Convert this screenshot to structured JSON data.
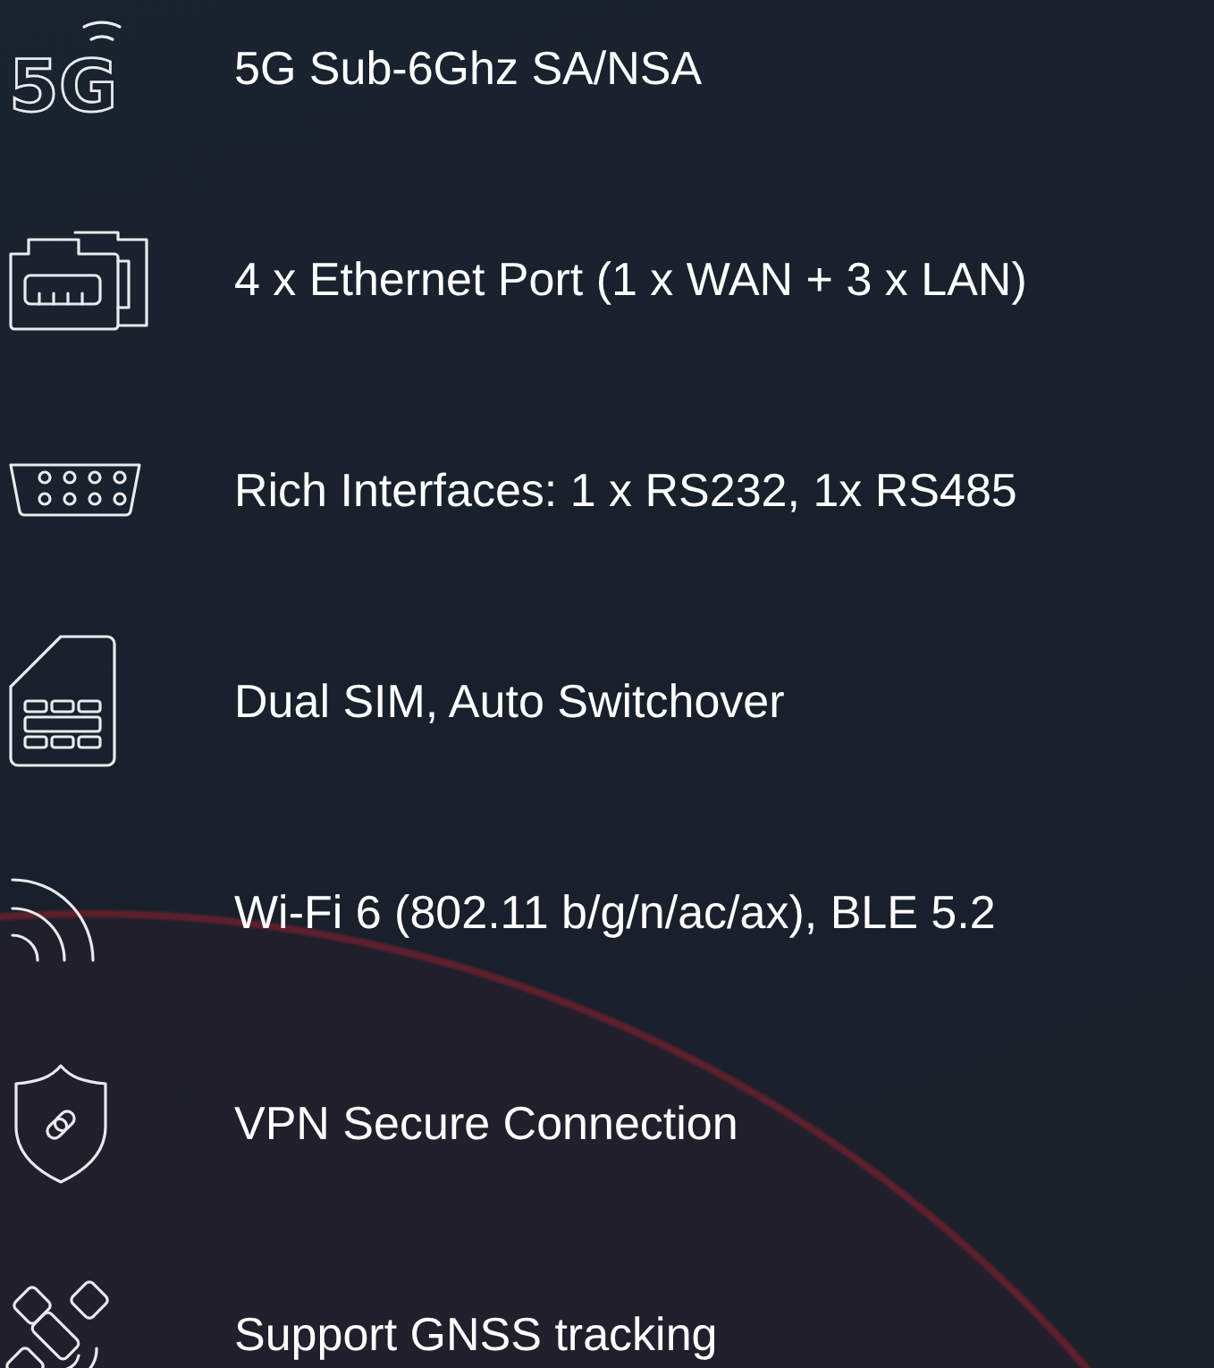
{
  "features": [
    {
      "kind": "cellular",
      "icon_text": "5G",
      "label": "5G Sub-6Ghz SA/NSA"
    },
    {
      "kind": "ethernet",
      "label": "4 x Ethernet Port (1 x WAN + 3 x LAN)"
    },
    {
      "kind": "serial",
      "label": "Rich Interfaces: 1 x RS232, 1x RS485"
    },
    {
      "kind": "sim",
      "label": "Dual SIM, Auto Switchover"
    },
    {
      "kind": "wifi",
      "label": "Wi-Fi 6 (802.11 b/g/n/ac/ax), BLE 5.2"
    },
    {
      "kind": "shield",
      "label": "VPN Secure Connection"
    },
    {
      "kind": "satellite",
      "label": "Support GNSS tracking"
    }
  ]
}
